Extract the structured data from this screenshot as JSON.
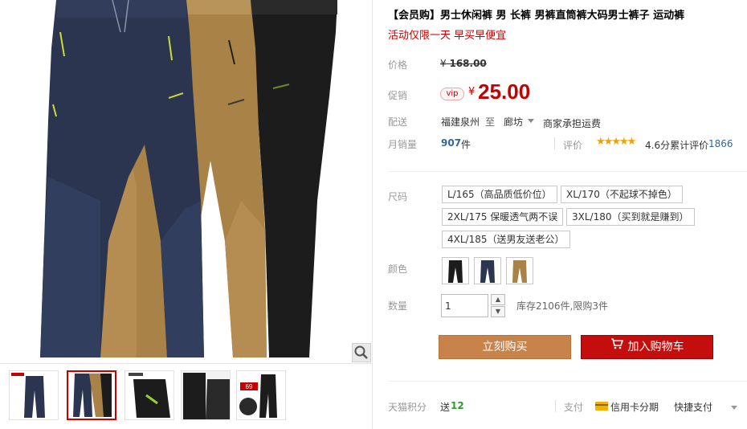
{
  "product": {
    "title": "【会员购】男士休闲裤 男 长裤 男裤直筒裤大码男士裤子 运动裤",
    "subtitle": "活动仅限一天 早买早便宜"
  },
  "price": {
    "label": "价格",
    "currency": "¥",
    "original": "168.00"
  },
  "promo": {
    "label": "促销",
    "badge": "vip",
    "currency": "¥",
    "price": "25.00"
  },
  "shipping": {
    "label": "配送",
    "from": "福建泉州",
    "to_word": "至",
    "destination": "廊坊",
    "fee": "商家承担运费"
  },
  "sales": {
    "label": "月销量",
    "count": "907",
    "unit": "件",
    "rating_label": "评价",
    "stars": "★★★★★",
    "rating_text": "4.6分累计评价",
    "review_count": "1866"
  },
  "sku": {
    "label": "尺码",
    "sizes": [
      "L/165（高品质低价位）",
      "XL/170（不起球不掉色）",
      "2XL/175 保暖透气两不误",
      "3XL/180（买到就是赚到）",
      "4XL/185（送男友送老公）"
    ]
  },
  "color": {
    "label": "颜色",
    "swatches": [
      "black",
      "navy",
      "khaki"
    ]
  },
  "quantity": {
    "label": "数量",
    "value": "1",
    "stock": "库存2106件,限购3件"
  },
  "actions": {
    "buy_now": "立刻购买",
    "add_to_cart": "加入购物车"
  },
  "footer": {
    "points_label": "天猫积分",
    "points_send": "送",
    "points_value": "12",
    "pay_label": "支付",
    "card_pay": "信用卡分期",
    "quick_pay": "快捷支付"
  },
  "thumbnails": {
    "badge": "69"
  },
  "icons": {
    "zoom": "magnifier-icon",
    "cart": "cart-icon"
  },
  "colors": {
    "navy": "#2b3550",
    "khaki": "#b08a4e",
    "black": "#1c1c1c",
    "brand_red": "#c40000",
    "buy_orange": "#c8834a"
  }
}
